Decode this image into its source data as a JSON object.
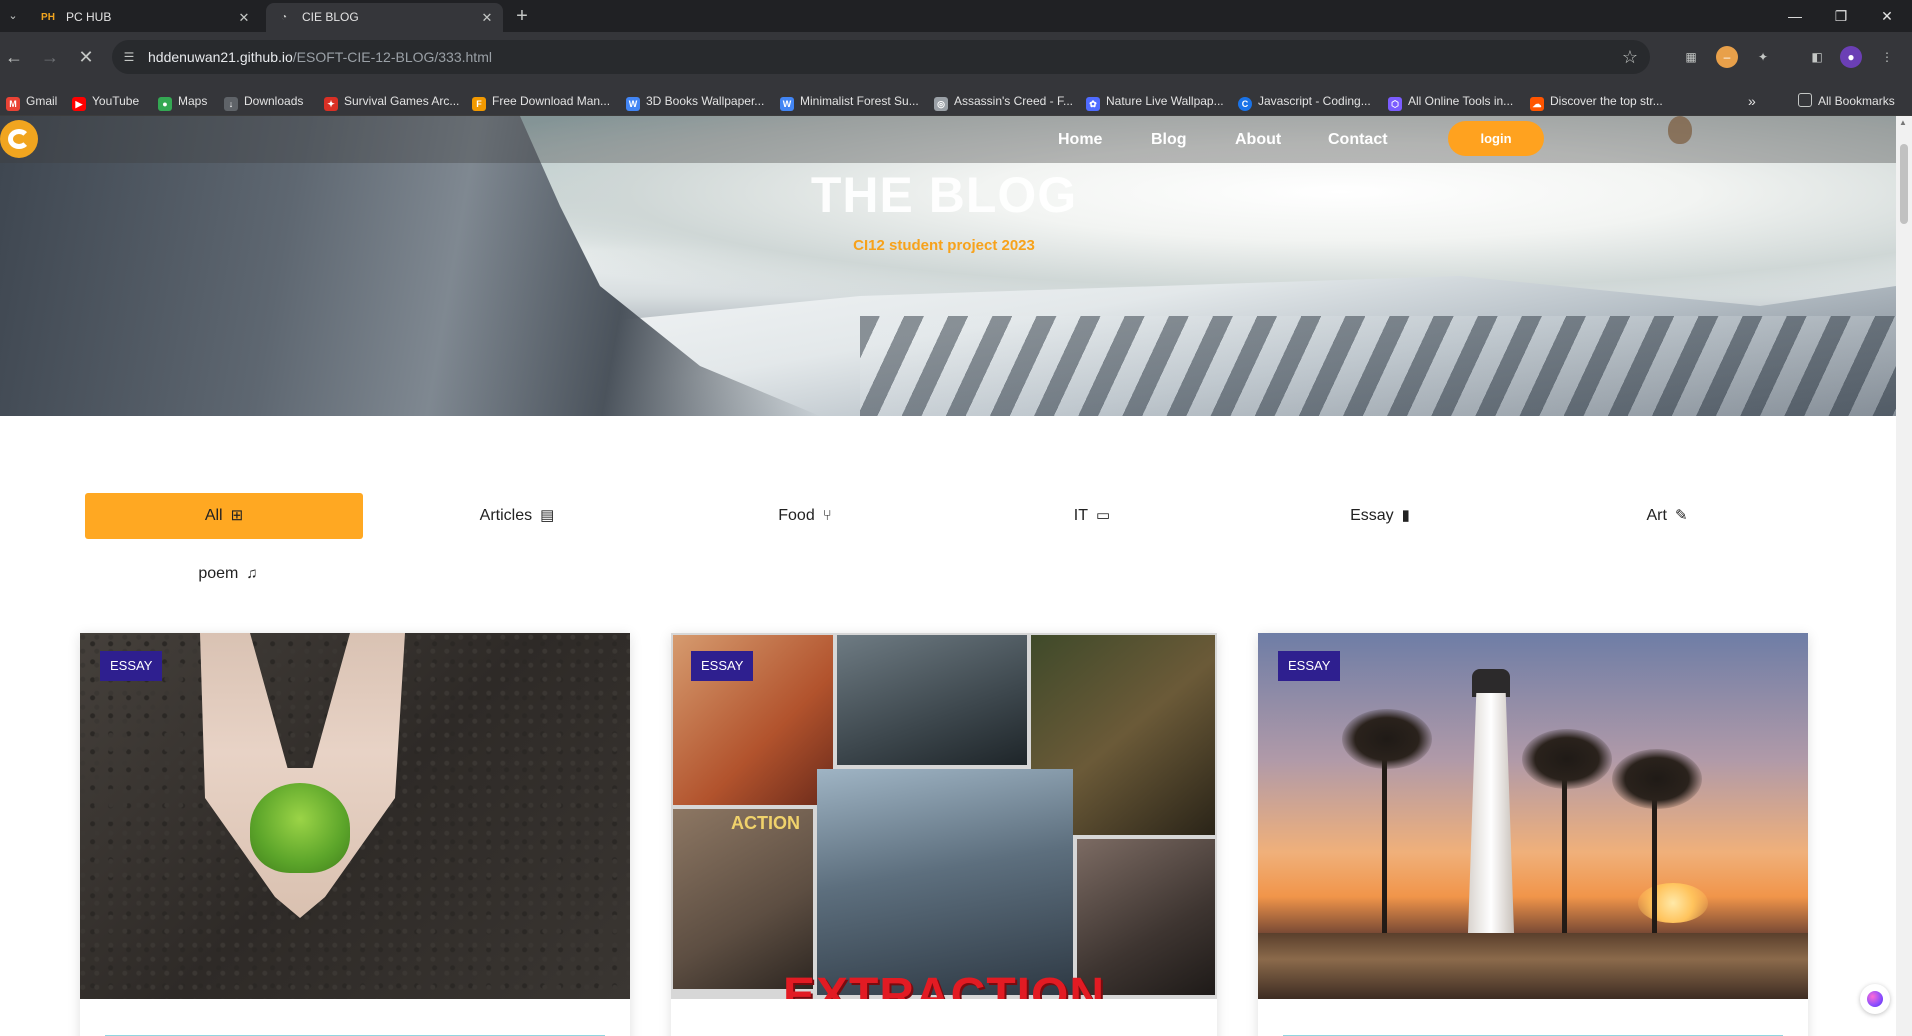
{
  "browser": {
    "tabs": [
      {
        "title": "PC HUB",
        "favicon": "pchub-icon",
        "active": false
      },
      {
        "title": "CIE BLOG",
        "favicon": "loading-icon",
        "active": true
      }
    ],
    "url_host": "hddenuwan21.github.io",
    "url_path": "/ESOFT-CIE-12-BLOG/333.html",
    "bookmarks": [
      {
        "label": "Gmail",
        "icon": "gmail-icon",
        "color": "#ea4335"
      },
      {
        "label": "YouTube",
        "icon": "youtube-icon",
        "color": "#ff0000"
      },
      {
        "label": "Maps",
        "icon": "maps-icon",
        "color": "#34a853"
      },
      {
        "label": "Downloads",
        "icon": "download-icon",
        "color": "#5f6368"
      },
      {
        "label": "Survival Games Arc...",
        "icon": "game-icon",
        "color": "#d93025"
      },
      {
        "label": "Free Download Man...",
        "icon": "fdm-icon",
        "color": "#f29900"
      },
      {
        "label": "3D Books Wallpaper...",
        "icon": "wallpaper-icon",
        "color": "#4285f4"
      },
      {
        "label": "Minimalist Forest Su...",
        "icon": "wallpaper-icon",
        "color": "#4285f4"
      },
      {
        "label": "Assassin's Creed - F...",
        "icon": "globe-icon",
        "color": "#9aa0a6"
      },
      {
        "label": "Nature Live Wallpap...",
        "icon": "nature-icon",
        "color": "#4f6bff"
      },
      {
        "label": "Javascript - Coding...",
        "icon": "js-icon",
        "color": "#1a73e8"
      },
      {
        "label": "All Online Tools in...",
        "icon": "tools-icon",
        "color": "#7b5cff"
      },
      {
        "label": "Discover the top str...",
        "icon": "soundcloud-icon",
        "color": "#ff5500"
      }
    ],
    "all_bookmarks": "All Bookmarks"
  },
  "site": {
    "nav": {
      "home": "Home",
      "blog": "Blog",
      "about": "About",
      "contact": "Contact",
      "login": "login"
    },
    "hero": {
      "title": "THE BLOG",
      "subtitle": "CI12 student project 2023"
    },
    "filters": [
      {
        "label": "All",
        "icon": "grid-icon",
        "glyph": "⊞",
        "active": true
      },
      {
        "label": "Articles",
        "icon": "newspaper-icon",
        "glyph": "▤",
        "active": false
      },
      {
        "label": "Food",
        "icon": "utensils-icon",
        "glyph": "⑂",
        "active": false
      },
      {
        "label": "IT",
        "icon": "devices-icon",
        "glyph": "▭",
        "active": false
      },
      {
        "label": "Essay",
        "icon": "book-icon",
        "glyph": "▮",
        "active": false
      },
      {
        "label": "Art",
        "icon": "brush-icon",
        "glyph": "✎",
        "active": false
      },
      {
        "label": "poem",
        "icon": "music-icon",
        "glyph": "♫",
        "active": false
      }
    ],
    "cards": [
      {
        "badge": "ESSAY",
        "image": "hands-holding-seedling"
      },
      {
        "badge": "ESSAY",
        "image": "extraction-movie-poster",
        "poster_title": "EXTRACTION",
        "poster_fragment": "ACTION"
      },
      {
        "badge": "ESSAY",
        "image": "lighthouse-at-sunset"
      }
    ]
  }
}
